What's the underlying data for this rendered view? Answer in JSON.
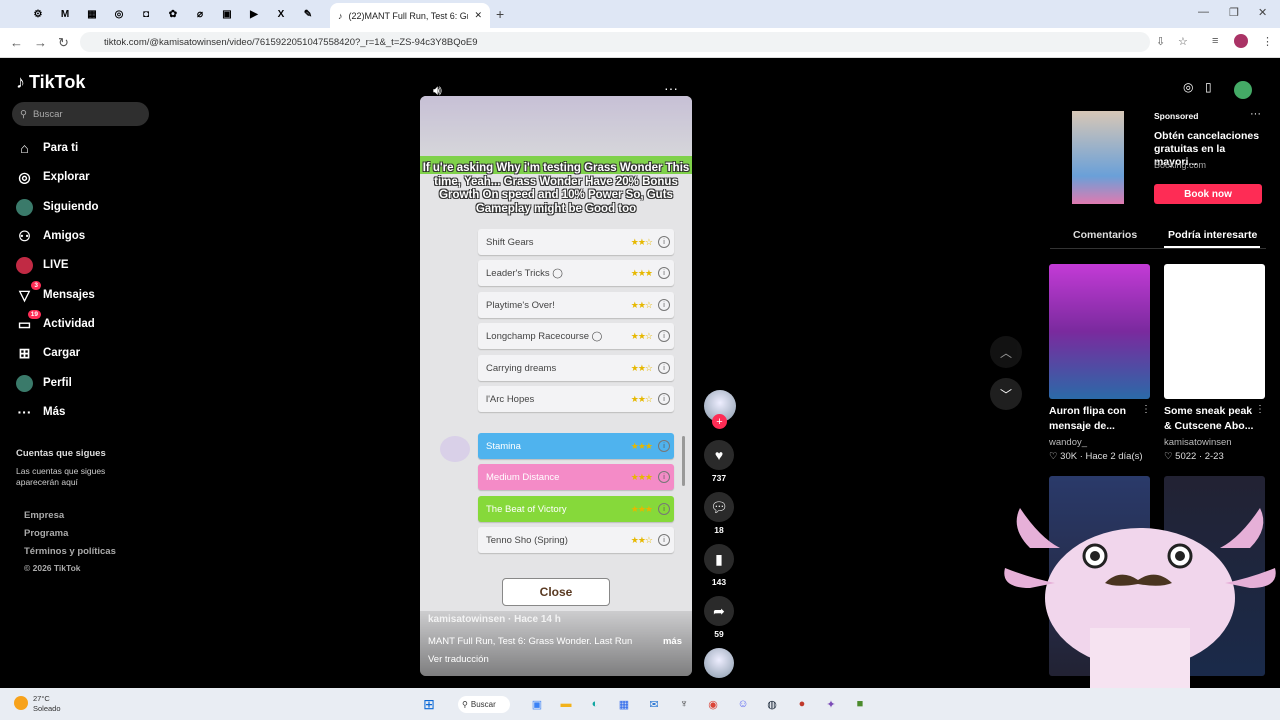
{
  "browser": {
    "active_tab_title": "(22)MANT Full Run, Test 6: Gras",
    "url": "tiktok.com/@kamisatowinsen/video/7615922051047558420?_r=1&_t=ZS-94c3Y8BQoE9",
    "tab_icons": [
      "⚙",
      "M",
      "▦",
      "◎",
      "◘",
      "✿",
      "⌀",
      "▣",
      "▶",
      "X",
      "✎"
    ]
  },
  "sidebar": {
    "logo": "TikTok",
    "search_placeholder": "Buscar",
    "items": [
      {
        "label": "Para ti",
        "icon": "home-icon",
        "glyph": "⌂"
      },
      {
        "label": "Explorar",
        "icon": "compass-icon",
        "glyph": "◎"
      },
      {
        "label": "Siguiendo",
        "icon": "following-avatar-icon",
        "glyph": "●"
      },
      {
        "label": "Amigos",
        "icon": "friends-icon",
        "glyph": "⚇"
      },
      {
        "label": "LIVE",
        "icon": "live-icon",
        "glyph": "●"
      },
      {
        "label": "Mensajes",
        "icon": "messages-icon",
        "glyph": "▽",
        "badge": "3"
      },
      {
        "label": "Actividad",
        "icon": "activity-icon",
        "glyph": "▭",
        "badge": "19"
      },
      {
        "label": "Cargar",
        "icon": "upload-icon",
        "glyph": "⊞"
      },
      {
        "label": "Perfil",
        "icon": "profile-avatar-icon",
        "glyph": "●"
      },
      {
        "label": "Más",
        "icon": "more-icon",
        "glyph": "···"
      }
    ],
    "following_heading": "Cuentas que sigues",
    "following_sub": "Las cuentas que sigues aparecerán aquí",
    "footer": [
      "Empresa",
      "Programa",
      "Términos y políticas",
      "© 2026 TikTok"
    ]
  },
  "video": {
    "caption": "If u're asking Why i'm testing Grass Wonder This time, Yeah... Grass Wonder Have 20% Bonus Growth On speed and 10% Power So, Guts Gameplay might be Good too",
    "skills": [
      {
        "name": "Shift Gears",
        "stars": "★★☆",
        "style": "plain"
      },
      {
        "name": "Leader's Tricks ◯",
        "stars": "★★★",
        "style": "plain"
      },
      {
        "name": "Playtime's Over!",
        "stars": "★★☆",
        "style": "plain"
      },
      {
        "name": "Longchamp Racecourse ◯",
        "stars": "★★☆",
        "style": "plain"
      },
      {
        "name": "Carrying dreams",
        "stars": "★★☆",
        "style": "plain"
      },
      {
        "name": "l'Arc Hopes",
        "stars": "★★☆",
        "style": "plain"
      },
      {
        "name": "Stamina",
        "stars": "★★★",
        "style": "blue"
      },
      {
        "name": "Medium Distance",
        "stars": "★★★",
        "style": "pink"
      },
      {
        "name": "The Beat of Victory",
        "stars": "★★★",
        "style": "green"
      },
      {
        "name": "Tenno Sho (Spring)",
        "stars": "★★☆",
        "style": "plain"
      }
    ],
    "close_label": "Close",
    "author": "kamisatowinsen · Hace 14 h",
    "description": "MANT Full Run, Test 6: Grass Wonder. Last Run",
    "more": "más",
    "translate": "Ver traducción"
  },
  "actions": {
    "likes": "737",
    "comments": "18",
    "saves": "143",
    "shares": "59"
  },
  "right": {
    "ad": {
      "sponsored": "Sponsored",
      "title": "Obtén cancelaciones gratuitas en la mayori...",
      "site": "Booking.com",
      "button": "Book now"
    },
    "tabs": [
      "Comentarios",
      "Podría interesarte"
    ],
    "cards": [
      {
        "title": "Auron flipa con mensaje de...",
        "user": "wandoy_",
        "stats": "♡ 30K · Hace 2 día(s)"
      },
      {
        "title": "Some sneak peak & Cutscene Abo...",
        "user": "kamisatowinsen",
        "stats": "♡ 5022 · 2-23"
      }
    ]
  },
  "taskbar": {
    "temp": "27°C",
    "weather": "Soleado",
    "search": "Buscar"
  },
  "colors": {
    "accent": "#fe2c55",
    "bg": "#000000"
  }
}
